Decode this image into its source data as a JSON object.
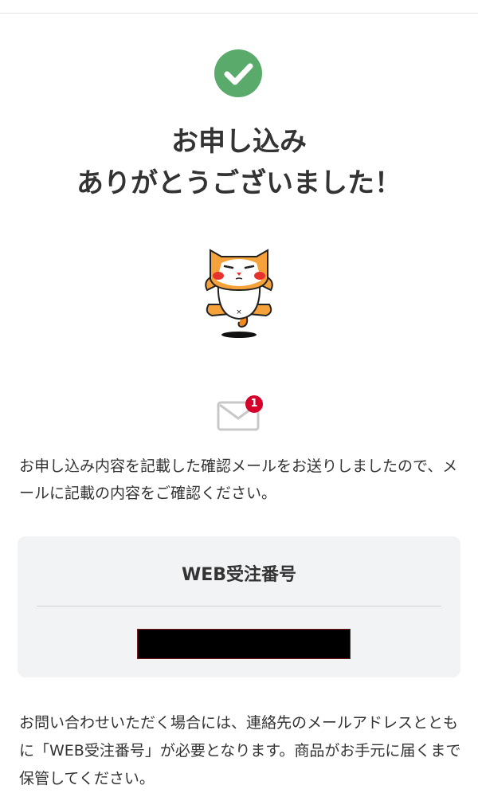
{
  "header": {
    "accent_color": "#5aab6b"
  },
  "confirmation": {
    "title_line1": "お申し込み",
    "title_line2": "ありがとうございました！",
    "icon": "check-circle-icon"
  },
  "mascot": {
    "icon": "cat-mascot-illustration"
  },
  "mail": {
    "icon": "envelope-icon",
    "badge_count": "1",
    "badge_color": "#d6002a"
  },
  "message": "お申し込み内容を記載した確認メールをお送りしましたので、メールに記載の内容をご確認ください。",
  "order": {
    "label": "WEB受注番号",
    "number_redacted": true
  },
  "inquiry": "お問い合わせいただく場合には、連絡先のメールアドレスとともに「WEB受注番号」が必要となります。商品がお手元に届くまで保管してください。"
}
